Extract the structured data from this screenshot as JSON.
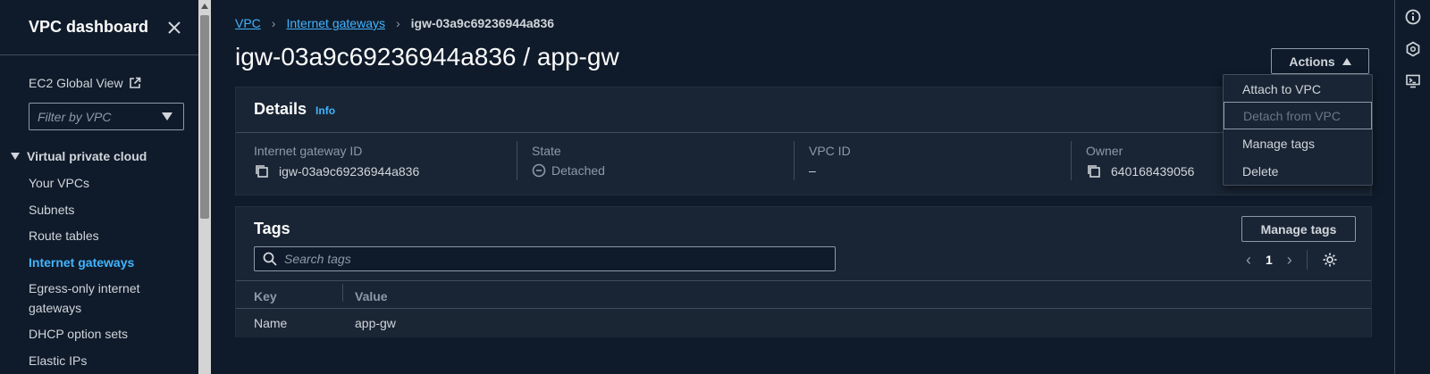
{
  "sidebar": {
    "title": "VPC dashboard",
    "ec2_global_view": "EC2 Global View",
    "filter_placeholder": "Filter by VPC",
    "section": "Virtual private cloud",
    "items": [
      {
        "label": "Your VPCs"
      },
      {
        "label": "Subnets"
      },
      {
        "label": "Route tables"
      },
      {
        "label": "Internet gateways",
        "active": true
      },
      {
        "label": "Egress-only internet"
      },
      {
        "label": "gateways"
      },
      {
        "label": "DHCP option sets"
      },
      {
        "label": "Elastic IPs"
      }
    ]
  },
  "breadcrumb": {
    "vpc": "VPC",
    "internet_gateways": "Internet gateways",
    "current": "igw-03a9c69236944a836"
  },
  "page": {
    "title": "igw-03a9c69236944a836 / app-gw",
    "actions_label": "Actions"
  },
  "details": {
    "heading": "Details",
    "info": "Info",
    "fields": {
      "gateway_id_label": "Internet gateway ID",
      "gateway_id": "igw-03a9c69236944a836",
      "state_label": "State",
      "state": "Detached",
      "vpc_id_label": "VPC ID",
      "vpc_id": "–",
      "owner_label": "Owner",
      "owner": "640168439056"
    }
  },
  "actions_menu": [
    {
      "label": "Attach to VPC",
      "disabled": false
    },
    {
      "label": "Detach from VPC",
      "disabled": true
    },
    {
      "label": "Manage tags",
      "disabled": false
    },
    {
      "label": "Delete",
      "disabled": false
    }
  ],
  "tags": {
    "heading": "Tags",
    "manage_label": "Manage tags",
    "search_placeholder": "Search tags",
    "page": "1",
    "columns": [
      "Key",
      "Value"
    ],
    "rows": [
      {
        "key": "Name",
        "value": "app-gw"
      }
    ]
  },
  "colors": {
    "background": "#0f1b2a",
    "panel": "#192534",
    "link": "#42b4ff"
  }
}
